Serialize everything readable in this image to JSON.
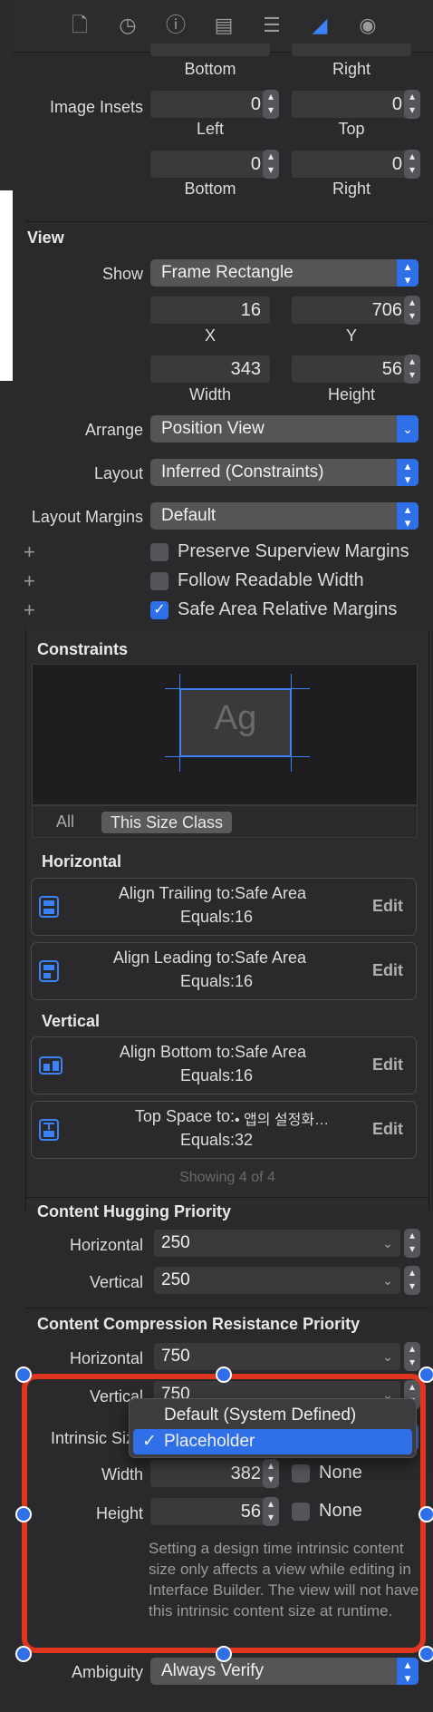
{
  "toolbar": {
    "icons": [
      "file-icon",
      "history-icon",
      "help-icon",
      "identity-icon",
      "attributes-icon",
      "size-ruler-icon",
      "connections-icon"
    ],
    "selected": "size-ruler-icon"
  },
  "insets_top": {
    "bottom_label": "Bottom",
    "right_label": "Right"
  },
  "image_insets": {
    "label": "Image Insets",
    "left_value": "0",
    "top_value": "0",
    "left_label": "Left",
    "top_label": "Top",
    "bottom_value": "0",
    "right_value": "0",
    "bottom_label": "Bottom",
    "right_label": "Right"
  },
  "view": {
    "title": "View",
    "show_label": "Show",
    "show_value": "Frame Rectangle",
    "x_value": "16",
    "y_value": "706",
    "x_label": "X",
    "y_label": "Y",
    "width_value": "343",
    "height_value": "56",
    "width_label": "Width",
    "height_label": "Height",
    "arrange_label": "Arrange",
    "arrange_value": "Position View",
    "layout_label": "Layout",
    "layout_value": "Inferred (Constraints)",
    "margins_label": "Layout Margins",
    "margins_value": "Default",
    "cb1": "Preserve Superview Margins",
    "cb2": "Follow Readable Width",
    "cb3": "Safe Area Relative Margins",
    "plus": "+"
  },
  "constraints": {
    "title": "Constraints",
    "preview_text": "Ag",
    "seg_all": "All",
    "seg_size": "This Size Class",
    "horizontal_title": "Horizontal",
    "vertical_title": "Vertical",
    "items": [
      {
        "line1": "Align Trailing to:",
        "target": "Safe Area",
        "line2": "Equals:",
        "value": "16",
        "edit": "Edit"
      },
      {
        "line1": "Align Leading to:",
        "target": "Safe Area",
        "line2": "Equals:",
        "value": "16",
        "edit": "Edit"
      },
      {
        "line1": "Align Bottom to:",
        "target": "Safe Area",
        "line2": "Equals:",
        "value": "16",
        "edit": "Edit"
      },
      {
        "line1": "Top Space to:",
        "target": "• 앱의 설정화…",
        "line2": "Equals:",
        "value": "32",
        "edit": "Edit"
      }
    ],
    "showing": "Showing 4 of 4"
  },
  "hugging": {
    "title": "Content Hugging Priority",
    "h_label": "Horizontal",
    "h_value": "250",
    "v_label": "Vertical",
    "v_value": "250"
  },
  "compression": {
    "title": "Content Compression Resistance Priority",
    "h_label": "Horizontal",
    "h_value": "750",
    "v_label": "Vertical",
    "v_value": "750"
  },
  "intrinsic": {
    "label": "Intrinsic Size",
    "menu_default": "Default (System Defined)",
    "menu_placeholder": "Placeholder",
    "check": "✓",
    "width_label": "Width",
    "width_value": "382",
    "width_none": "None",
    "height_label": "Height",
    "height_value": "56",
    "height_none": "None",
    "note": "Setting a design time intrinsic content size only affects a view while editing in Interface Builder. The view will not have this intrinsic content size at runtime."
  },
  "ambiguity": {
    "label": "Ambiguity",
    "value": "Always Verify"
  },
  "colors": {
    "accent": "#2f6fe8",
    "highlight": "#e0361f",
    "panel": "#2a2a2c"
  }
}
